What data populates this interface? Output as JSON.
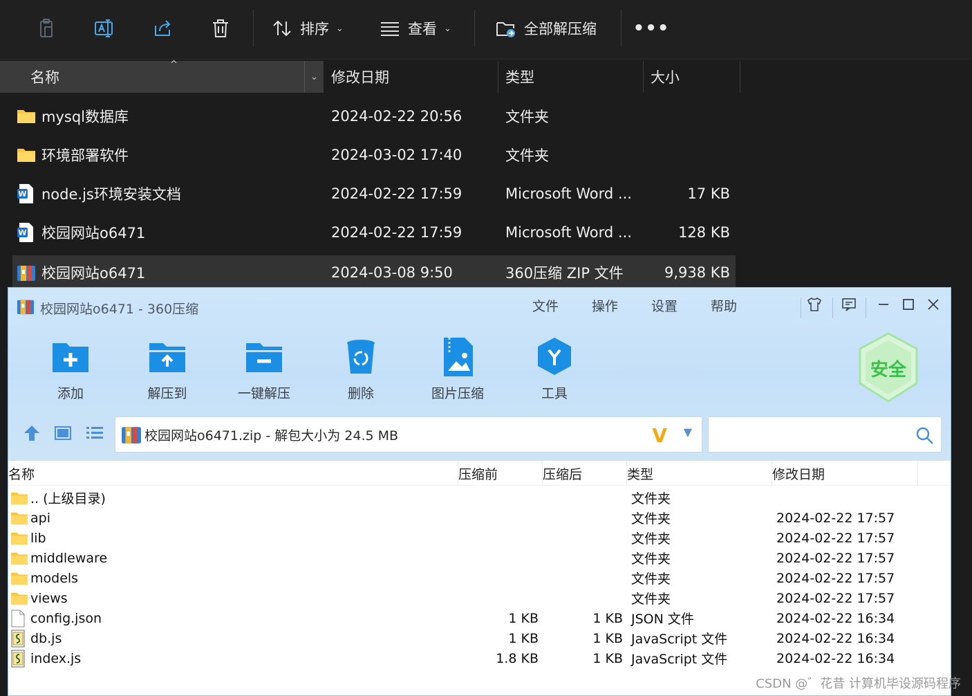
{
  "explorer": {
    "toolbar": {
      "sort_label": "排序",
      "view_label": "查看",
      "extract_all_label": "全部解压缩"
    },
    "columns": {
      "name": "名称",
      "modified": "修改日期",
      "type": "类型",
      "size": "大小"
    },
    "rows": [
      {
        "icon": "folder-icon",
        "name": "mysql数据库",
        "modified": "2024-02-22 20:56",
        "type": "文件夹",
        "size": ""
      },
      {
        "icon": "folder-icon",
        "name": "环境部署软件",
        "modified": "2024-03-02 17:40",
        "type": "文件夹",
        "size": ""
      },
      {
        "icon": "word-doc-icon",
        "name": "node.js环境安装文档",
        "modified": "2024-02-22 17:59",
        "type": "Microsoft Word ...",
        "size": "17 KB"
      },
      {
        "icon": "word-doc-icon",
        "name": "校园网站o6471",
        "modified": "2024-02-22 17:59",
        "type": "Microsoft Word ...",
        "size": "128 KB"
      },
      {
        "icon": "zip-archive-icon",
        "name": "校园网站o6471",
        "modified": "2024-03-08 9:50",
        "type": "360压缩 ZIP 文件",
        "size": "9,938 KB"
      }
    ]
  },
  "zip_window": {
    "title": "校园网站o6471 - 360压缩",
    "menu": [
      "文件",
      "操作",
      "设置",
      "帮助"
    ],
    "tools": [
      "添加",
      "解压到",
      "一键解压",
      "删除",
      "图片压缩",
      "工具"
    ],
    "badge": "安全",
    "address": "校园网站o6471.zip - 解包大小为 24.5 MB",
    "address_brand": "V",
    "search": {
      "placeholder": ""
    },
    "columns": {
      "name": "名称",
      "before": "压缩前",
      "after": "压缩后",
      "type": "类型",
      "modified": "修改日期"
    },
    "rows": [
      {
        "icon": "folder-icon",
        "name": ".. (上级目录)",
        "before": "",
        "after": "",
        "type": "文件夹",
        "modified": ""
      },
      {
        "icon": "folder-icon",
        "name": "api",
        "before": "",
        "after": "",
        "type": "文件夹",
        "modified": "2024-02-22 17:57"
      },
      {
        "icon": "folder-icon",
        "name": "lib",
        "before": "",
        "after": "",
        "type": "文件夹",
        "modified": "2024-02-22 17:57"
      },
      {
        "icon": "folder-icon",
        "name": "middleware",
        "before": "",
        "after": "",
        "type": "文件夹",
        "modified": "2024-02-22 17:57"
      },
      {
        "icon": "folder-icon",
        "name": "models",
        "before": "",
        "after": "",
        "type": "文件夹",
        "modified": "2024-02-22 17:57"
      },
      {
        "icon": "folder-icon",
        "name": "views",
        "before": "",
        "after": "",
        "type": "文件夹",
        "modified": "2024-02-22 17:57"
      },
      {
        "icon": "file-icon",
        "name": "config.json",
        "before": "1 KB",
        "after": "1 KB",
        "type": "JSON 文件",
        "modified": "2024-02-22 16:34"
      },
      {
        "icon": "js-script-icon",
        "name": "db.js",
        "before": "1 KB",
        "after": "1 KB",
        "type": "JavaScript 文件",
        "modified": "2024-02-22 16:34"
      },
      {
        "icon": "js-script-icon",
        "name": "index.js",
        "before": "1.8 KB",
        "after": "1 KB",
        "type": "JavaScript 文件",
        "modified": "2024-02-22 16:34"
      }
    ]
  },
  "watermark": "CSDN @゛花昔  计算机毕设源码程序",
  "colors": {
    "explorer_bg": "#1c1c1c",
    "zip_header_bg": "#cfe6fa",
    "accent_blue": "#1a8fe3",
    "folder": "#f8c840"
  }
}
